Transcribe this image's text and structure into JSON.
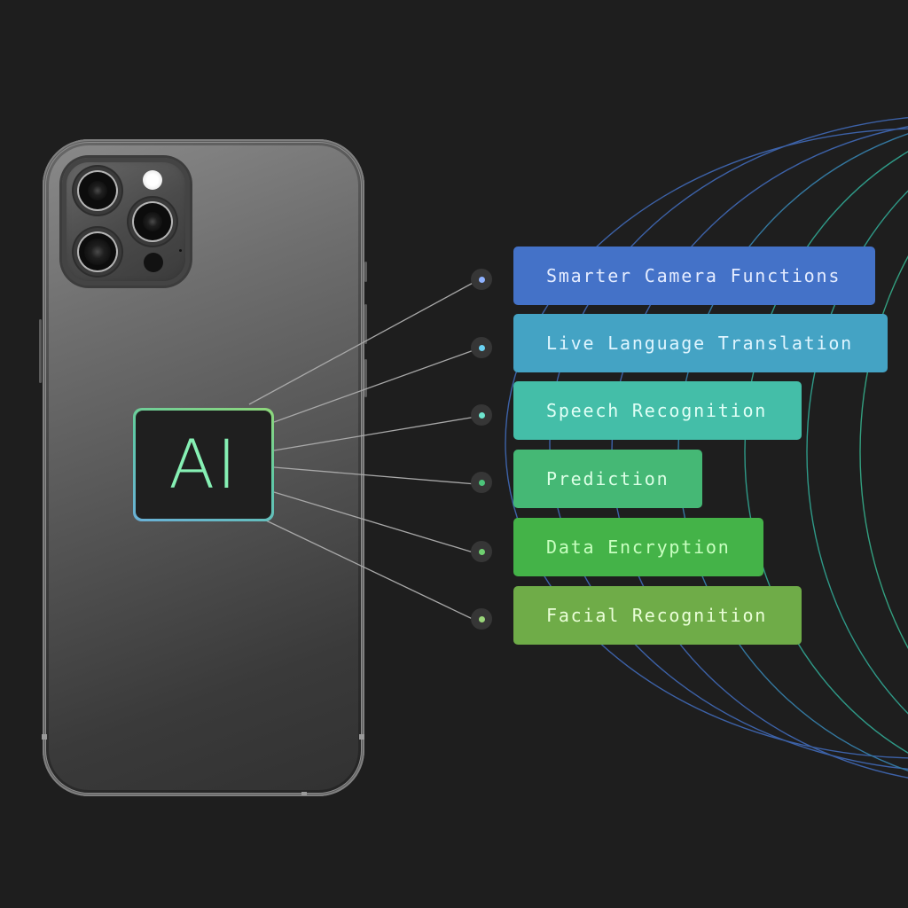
{
  "diagram": {
    "center_label": "AI",
    "subject": "smartphone-rear",
    "features": [
      {
        "label": "Smarter Camera Functions",
        "box_color": "#4472c8",
        "text_color": "#e4ecff",
        "dot_color": "#8fb2ff"
      },
      {
        "label": "Live Language Translation",
        "box_color": "#44a3c4",
        "text_color": "#def5ff",
        "dot_color": "#6ad2f2"
      },
      {
        "label": "Speech Recognition",
        "box_color": "#44bea8",
        "text_color": "#e0fff6",
        "dot_color": "#6ee6cf"
      },
      {
        "label": "Prediction",
        "box_color": "#45b875",
        "text_color": "#dcffe6",
        "dot_color": "#4cc47a"
      },
      {
        "label": "Data Encryption",
        "box_color": "#44b348",
        "text_color": "#c8ffc0",
        "dot_color": "#6fd070"
      },
      {
        "label": "Facial Recognition",
        "box_color": "#6fac48",
        "text_color": "#eaffd8",
        "dot_color": "#9ad67a"
      }
    ],
    "colors": {
      "background": "#1e1e1e",
      "ai_text": "#86f0b4",
      "connector": "#a8a8a8",
      "arc_blue": "#3d62a8",
      "arc_teal": "#2f9a88",
      "arc_green": "#3ea870"
    }
  }
}
